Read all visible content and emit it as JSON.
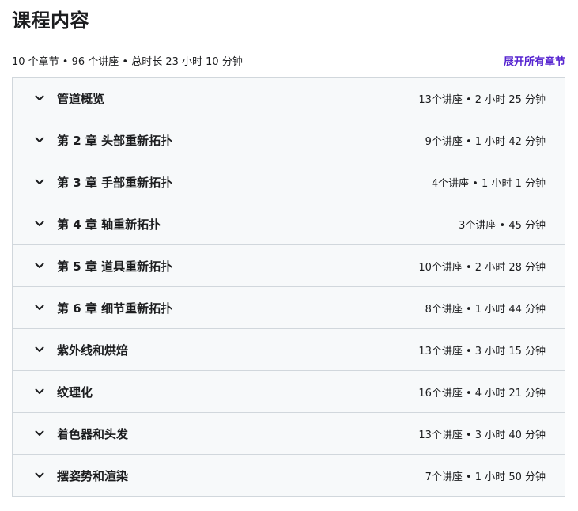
{
  "header": {
    "title": "课程内容",
    "summary": "10 个章节 • 96 个讲座 • 总时长 23 小时 10 分钟",
    "expand_all_label": "展开所有章节"
  },
  "icons": {
    "chevron": "chevron-down-icon"
  },
  "colors": {
    "accent": "#5624d0",
    "section_bg": "#f7f9fa",
    "border": "#d1d7dc",
    "text": "#1c1d1f"
  },
  "sections": [
    {
      "title": "管道概览",
      "meta": "13个讲座 • 2 小时 25 分钟"
    },
    {
      "title": "第 2 章 头部重新拓扑",
      "meta": "9个讲座 • 1 小时 42 分钟"
    },
    {
      "title": "第 3 章 手部重新拓扑",
      "meta": "4个讲座 • 1 小时 1 分钟"
    },
    {
      "title": "第 4 章 轴重新拓扑",
      "meta": "3个讲座 • 45 分钟"
    },
    {
      "title": "第 5 章 道具重新拓扑",
      "meta": "10个讲座 • 2 小时 28 分钟"
    },
    {
      "title": "第 6 章 细节重新拓扑",
      "meta": "8个讲座 • 1 小时 44 分钟"
    },
    {
      "title": "紫外线和烘焙",
      "meta": "13个讲座 • 3 小时 15 分钟"
    },
    {
      "title": "纹理化",
      "meta": "16个讲座 • 4 小时 21 分钟"
    },
    {
      "title": "着色器和头发",
      "meta": "13个讲座 • 3 小时 40 分钟"
    },
    {
      "title": "摆姿势和渲染",
      "meta": "7个讲座 • 1 小时 50 分钟"
    }
  ]
}
